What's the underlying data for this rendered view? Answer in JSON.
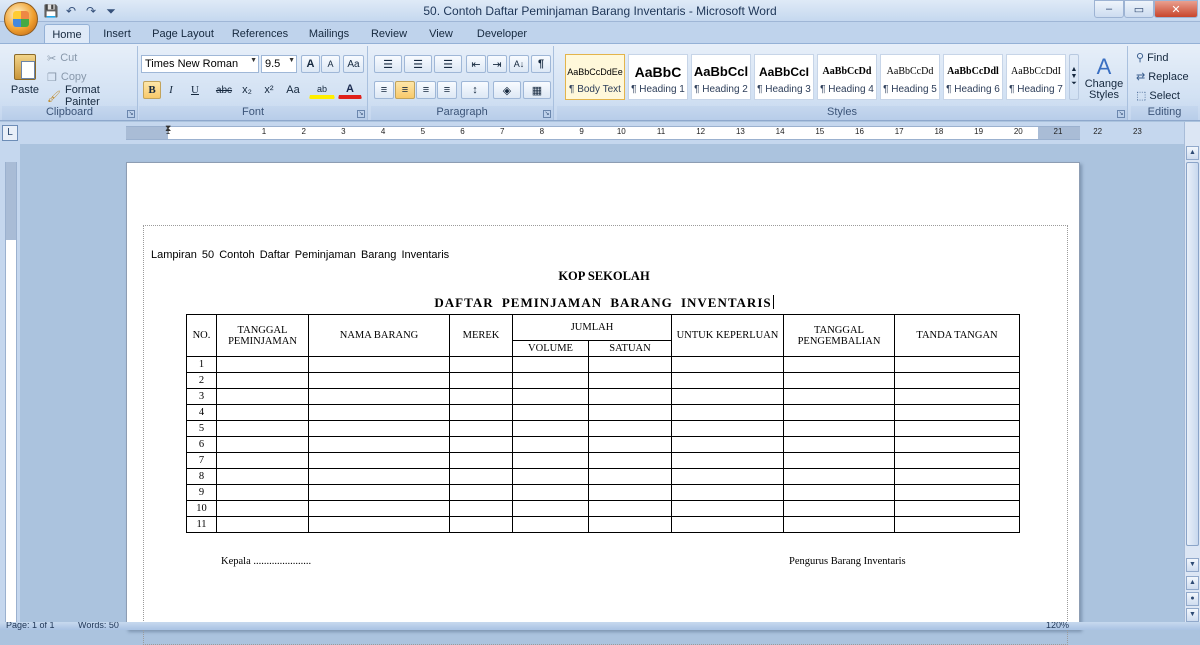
{
  "window": {
    "title": "50. Contoh Daftar Peminjaman Barang Inventaris - Microsoft Word",
    "minimize": "–",
    "restore": "▭",
    "close": "✕"
  },
  "qat": {
    "save": "💾",
    "undo": "↶",
    "redo": "↷",
    "customize": "⏷"
  },
  "tabs": [
    "Home",
    "Insert",
    "Page Layout",
    "References",
    "Mailings",
    "Review",
    "View",
    "Developer"
  ],
  "ribbon": {
    "clipboard": {
      "label": "Clipboard",
      "paste": "Paste",
      "cut": "Cut",
      "copy": "Copy",
      "format_painter": "Format Painter"
    },
    "font": {
      "label": "Font",
      "font_name": "Times New Roman",
      "font_size": "9.5",
      "grow": "A",
      "shrink": "A",
      "clear": "Aa",
      "bold": "B",
      "italic": "I",
      "underline": "U",
      "strike": "abc",
      "subscript": "x₂",
      "superscript": "x²",
      "change_case": "Aa",
      "highlight": "ab",
      "font_color": "A"
    },
    "paragraph": {
      "label": "Paragraph",
      "bullets": "☰",
      "numbering": "☰",
      "multilevel": "☰",
      "decrease_indent": "⇤",
      "increase_indent": "⇥",
      "sort": "A↓",
      "show_marks": "¶",
      "align_left": "≡",
      "center": "≡",
      "align_right": "≡",
      "justify": "≡",
      "line_spacing": "↕",
      "shading": "◈",
      "borders": "▦"
    },
    "styles": {
      "label": "Styles",
      "items": [
        {
          "preview": "AaBbCcDdEe",
          "name": "¶ Body Text"
        },
        {
          "preview": "AaBbC",
          "name": "¶ Heading 1"
        },
        {
          "preview": "AaBbCcl",
          "name": "¶ Heading 2"
        },
        {
          "preview": "AaBbCcI",
          "name": "¶ Heading 3"
        },
        {
          "preview": "AaBbCcDd",
          "name": "¶ Heading 4"
        },
        {
          "preview": "AaBbCcDd",
          "name": "¶ Heading 5"
        },
        {
          "preview": "AaBbCcDdl",
          "name": "¶ Heading 6"
        },
        {
          "preview": "AaBbCcDdI",
          "name": "¶ Heading 7"
        }
      ],
      "change_styles": "Change Styles"
    },
    "editing": {
      "label": "Editing",
      "find": "Find",
      "replace": "Replace",
      "select": "Select"
    }
  },
  "ruler": {
    "numbers": [
      "1",
      "1",
      "2",
      "3",
      "4",
      "5",
      "6",
      "7",
      "8",
      "9",
      "10",
      "11",
      "12",
      "13",
      "14",
      "15",
      "16",
      "17",
      "18",
      "19",
      "20",
      "21",
      "22",
      "23"
    ]
  },
  "document": {
    "intro": "Lampiran 50 Contoh Daftar Peminjaman Barang Inventaris",
    "kop": "KOP SEKOLAH",
    "heading": "DAFTAR PEMINJAMAN BARANG INVENTARIS",
    "table": {
      "headers": {
        "no": "NO.",
        "tanggal_pinjam": "TANGGAL PEMINJAMAN",
        "nama_barang": "NAMA BARANG",
        "merek": "MEREK",
        "jumlah": "JUMLAH",
        "volume": "VOLUME",
        "satuan": "SATUAN",
        "untuk_keperluan": "UNTUK KEPERLUAN",
        "tanggal_kembali": "TANGGAL PENGEMBALIAN",
        "tanda_tangan": "TANDA TANGAN"
      },
      "row_numbers": [
        "1",
        "2",
        "3",
        "4",
        "5",
        "6",
        "7",
        "8",
        "9",
        "10",
        "11"
      ]
    },
    "signature_left": "Kepala ......................",
    "signature_right": "Pengurus Barang Inventaris"
  },
  "status": {
    "page": "Page: 1 of 1",
    "words": "Words: 50",
    "zoom": "120%"
  }
}
